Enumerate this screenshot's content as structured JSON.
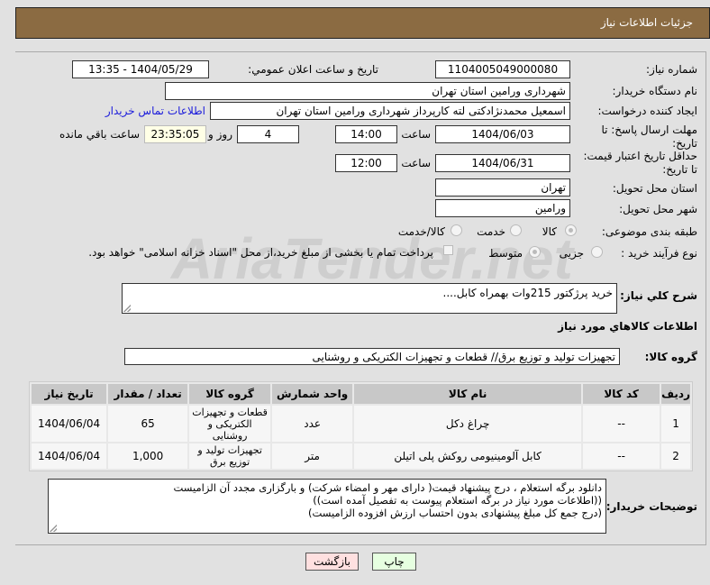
{
  "header": {
    "title": "جزئیات اطلاعات نیاز"
  },
  "form": {
    "need_number_label": "شماره نیاز:",
    "need_number": "1104005049000080",
    "announce_label": "تاریخ و ساعت اعلان عمومي:",
    "announce_value": "1404/05/29 - 13:35",
    "buyer_org_label": "نام دستگاه خریدار:",
    "buyer_org": "شهرداری ورامین استان تهران",
    "creator_label": "ایجاد کننده درخواست:",
    "creator": "اسمعیل محمدنژادکتی لته کارپرداز شهرداری ورامین استان تهران",
    "contact_link": "اطلاعات تماس خریدار",
    "deadline_label": "مهلت ارسال پاسخ: تا تاریخ:",
    "deadline_date": "1404/06/03",
    "time_label": "ساعت",
    "deadline_time": "14:00",
    "days": "4",
    "days_label": "روز و",
    "remaining": "23:35:05",
    "remaining_label": "ساعت باقي مانده",
    "validity_label": "حداقل تاریخ اعتبار قیمت: تا تاریخ:",
    "validity_date": "1404/06/31",
    "validity_time": "12:00",
    "province_label": "استان محل تحویل:",
    "province": "تهران",
    "city_label": "شهر محل تحویل:",
    "city": "ورامین",
    "category_label": "طبقه بندی موضوعی:",
    "category_options": [
      "کالا",
      "خدمت",
      "کالا/خدمت"
    ],
    "process_label": "نوع فرآیند خرید :",
    "process_options": [
      "جزیی",
      "متوسط"
    ],
    "payment_note": "پرداخت تمام یا بخشی از مبلغ خرید،از محل \"اسناد خزانه اسلامی\" خواهد بود.",
    "summary_label": "شرح کلي نیاز:",
    "summary": "خرید پرژکتور 215وات بهمراه کابل....",
    "goods_heading": "اطلاعات کالاهاي مورد نیاز",
    "group_label": "گروه کالا:",
    "group": "تجهیزات تولید و توزیع برق// قطعات و تجهیزات الکتریکی و روشنایی",
    "notes_label": "توضیحات خریدار:",
    "notes": [
      "دانلود برگه استعلام ، درج پیشنهاد قیمت( دارای مهر و امضاء شرکت) و بارگزاری مجدد آن الزامیست",
      "((اطلاعات مورد نیاز در برگه استعلام پیوست به تفصیل آمده است))",
      "(درج  جمع کل مبلغ پیشنهادی بدون احتساب ارزش افزوده الزامیست)"
    ]
  },
  "table": {
    "headers": [
      "ردیف",
      "کد کالا",
      "نام کالا",
      "واحد شمارش",
      "گروه کالا",
      "تعداد / مقدار",
      "تاریخ نیاز"
    ],
    "rows": [
      [
        "1",
        "--",
        "چراغ دکل",
        "عدد",
        "قطعات و تجهیزات الکتریکی و روشنایی",
        "65",
        "1404/06/04"
      ],
      [
        "2",
        "--",
        "کابل آلومینیومی روکش پلی اتیلن",
        "متر",
        "تجهیزات تولید و توزیع برق",
        "1,000",
        "1404/06/04"
      ]
    ]
  },
  "buttons": {
    "print": "چاپ",
    "back": "بازگشت"
  },
  "watermark": "AriaTender.net"
}
